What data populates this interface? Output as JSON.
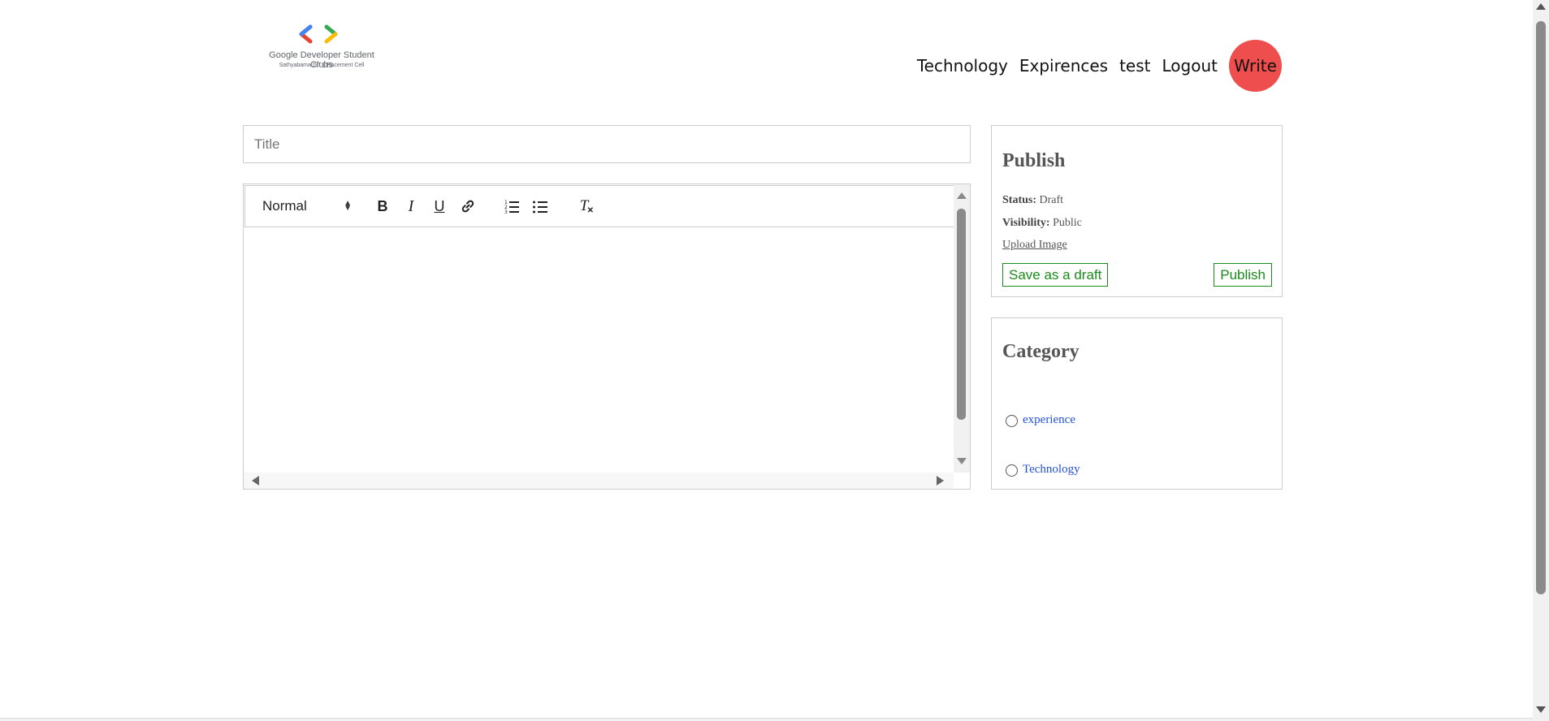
{
  "header": {
    "logo_line1": "Google Developer Student Clubs",
    "logo_line2": "Sathyabama IST | Placement Cell",
    "nav": [
      "Technology",
      "Expirences",
      "test",
      "Logout"
    ],
    "write_label": "Write",
    "write_color": "#ef4e4e"
  },
  "editor": {
    "title_placeholder": "Title",
    "title_value": "",
    "format_select": "Normal",
    "toolbar_icons": [
      "bold-icon",
      "italic-icon",
      "underline-icon",
      "link-icon",
      "ordered-list-icon",
      "bullet-list-icon",
      "clear-format-icon"
    ],
    "bold_glyph": "B",
    "italic_glyph": "I",
    "underline_glyph": "U",
    "clear_glyph": "T"
  },
  "publish": {
    "heading": "Publish",
    "status_label": "Status:",
    "status_value": "Draft",
    "visibility_label": "Visibility:",
    "visibility_value": "Public",
    "upload_label": "Upload Image",
    "save_draft_label": "Save as a draft",
    "publish_label": "Publish",
    "accent_color": "#1a8a1a"
  },
  "category": {
    "heading": "Category",
    "options": [
      "experience",
      "Technology"
    ]
  }
}
